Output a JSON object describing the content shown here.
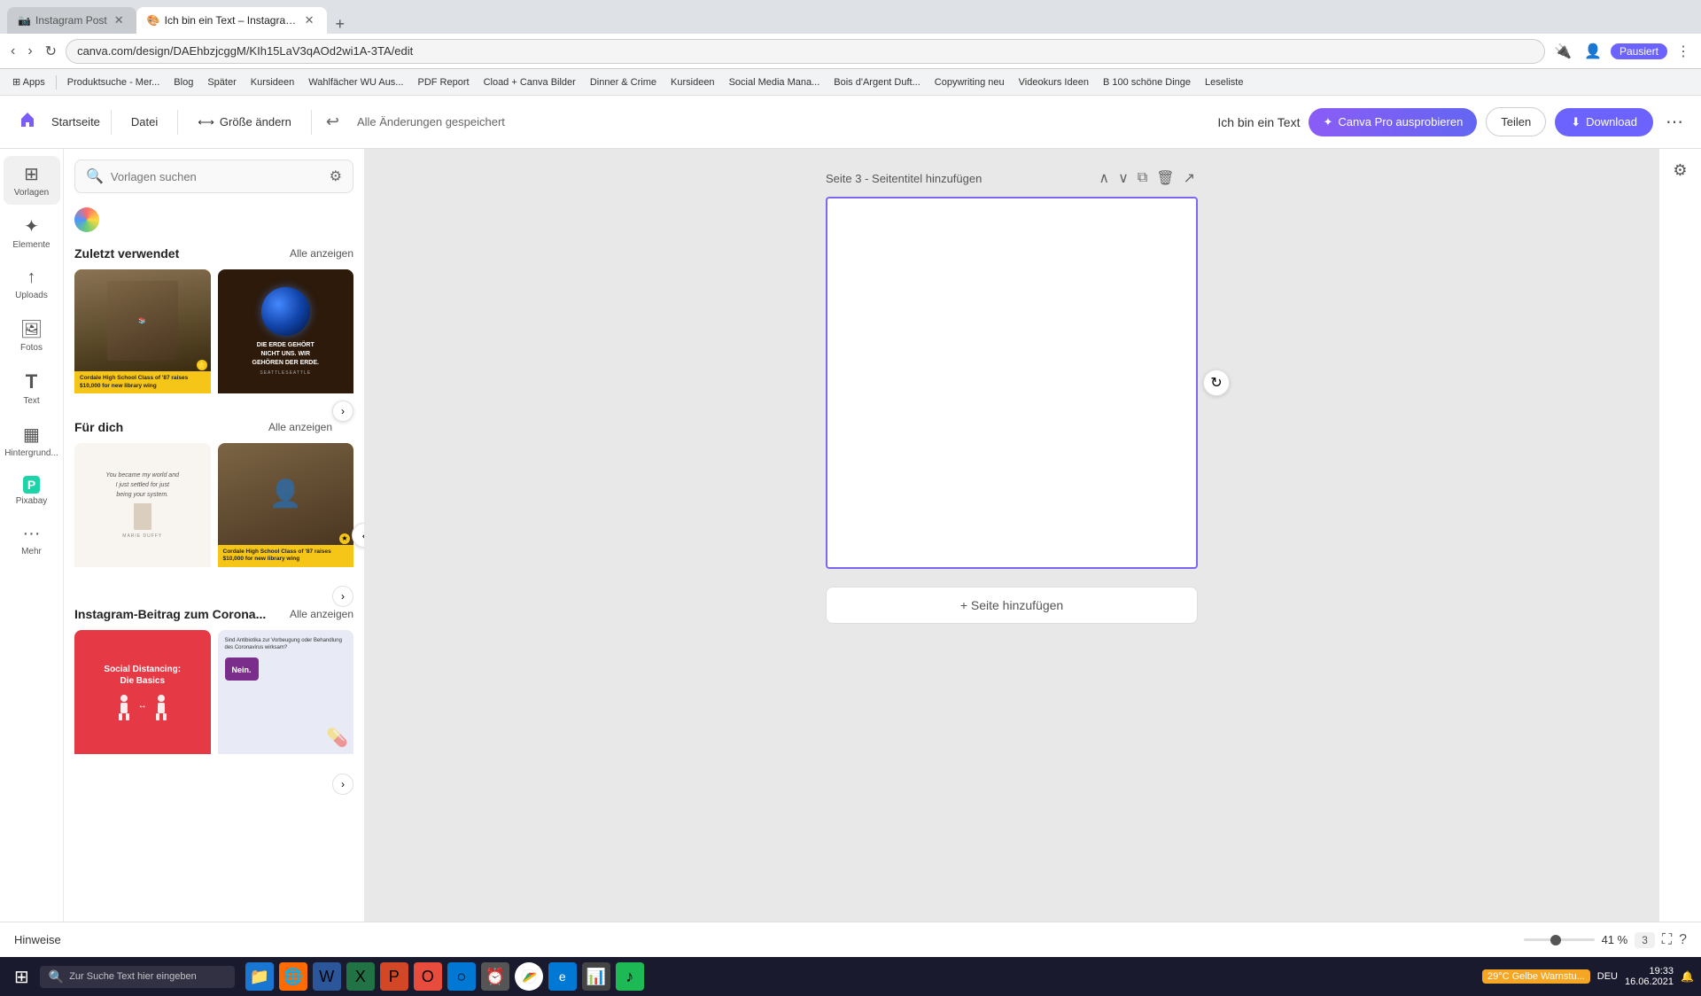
{
  "browser": {
    "tabs": [
      {
        "id": "tab1",
        "title": "Instagram Post",
        "favicon": "📷",
        "active": false
      },
      {
        "id": "tab2",
        "title": "Ich bin ein Text – Instagram-Bei...",
        "favicon": "🎨",
        "active": true
      }
    ],
    "address": "canva.com/design/DAEhbzjcggM/KIh15LaV3qAOd2wi1A-3TA/edit",
    "bookmarks": [
      "Apps",
      "Produktsuche - Mer...",
      "Blog",
      "Später",
      "Kursideen",
      "Wahlfächer WU Aus...",
      "PDF Report",
      "Cload + Canva Bilder",
      "Dinner & Crime",
      "Kursideen",
      "Social Media Mana...",
      "Bois d'Argent Duft...",
      "Copywriting neu",
      "Videokurs Ideen",
      "100 schöne Dinge",
      "Leseliste"
    ]
  },
  "toolbar": {
    "home_label": "Startseite",
    "file_label": "Datei",
    "resize_label": "Größe ändern",
    "autosave": "Alle Änderungen gespeichert",
    "title_label": "Ich bin ein Text",
    "canva_pro_label": "Canva Pro ausprobieren",
    "share_label": "Teilen",
    "download_label": "Download"
  },
  "sidebar": {
    "items": [
      {
        "id": "vorlagen",
        "label": "Vorlagen",
        "icon": "⊞",
        "active": true
      },
      {
        "id": "elemente",
        "label": "Elemente",
        "icon": "✦"
      },
      {
        "id": "uploads",
        "label": "Uploads",
        "icon": "↑"
      },
      {
        "id": "fotos",
        "label": "Fotos",
        "icon": "🖼"
      },
      {
        "id": "text",
        "label": "Text",
        "icon": "T"
      },
      {
        "id": "hintergrund",
        "label": "Hintergrund...",
        "icon": "▦"
      },
      {
        "id": "pixabay",
        "label": "Pixabay",
        "icon": "P"
      },
      {
        "id": "mehr",
        "label": "Mehr",
        "icon": "···"
      }
    ]
  },
  "panel": {
    "search_placeholder": "Vorlagen suchen",
    "recently_used": {
      "title": "Zuletzt verwendet",
      "show_all": "Alle anzeigen"
    },
    "for_you": {
      "title": "Für dich",
      "show_all": "Alle anzeigen"
    },
    "corona": {
      "title": "Instagram-Beitrag zum Corona...",
      "show_all": "Alle anzeigen"
    },
    "templates": {
      "recently_1_caption": "Cordale High School Class of '87 raises $10,000 for new library wing",
      "recently_2_text1": "DIE ERDE GEHÖRT",
      "recently_2_text2": "NICHT UNS. WIR",
      "recently_2_text3": "GEHÖREN DER ERDE.",
      "foryou_1_text1": "You became my world and",
      "foryou_1_text2": "I just settled for just",
      "foryou_1_text3": "being your system.",
      "foryou_1_author": "MARIE DUFFY",
      "foryou_2_caption": "Cordale High School Class of '87 raises $10,000 for new library wing",
      "corona_1_title": "Social Distancing:",
      "corona_1_subtitle": "Die Basics",
      "corona_2_question": "Sind Antibiotika zur Vorbeugung oder Behandlung des Coronavirus wirksam?",
      "corona_2_answer": "Nein."
    }
  },
  "canvas": {
    "page3_title": "Seite 3 - Seitentitel hinzufügen",
    "add_page": "+ Seite hinzufügen"
  },
  "bottom": {
    "hints": "Hinweise",
    "zoom": "41 %",
    "page_num": "3"
  },
  "taskbar": {
    "search_placeholder": "Zur Suche Text hier eingeben",
    "weather": "29°C Gelbe Warnstu...",
    "time": "19:33",
    "date": "16.06.2021",
    "lang": "DEU"
  }
}
